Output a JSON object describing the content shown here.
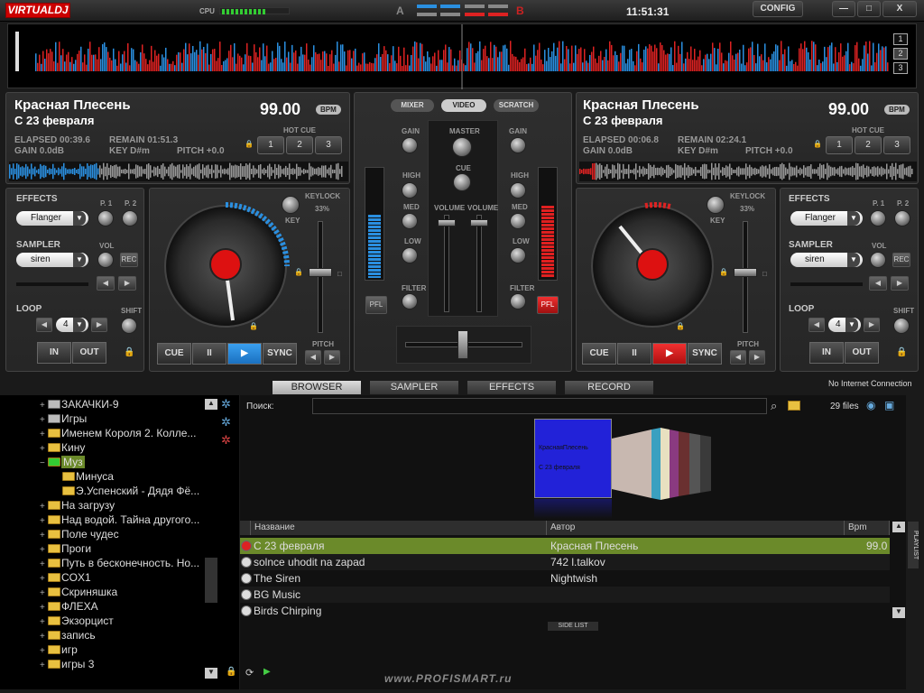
{
  "titlebar": {
    "logo": "VIRTUALDJ",
    "cpu_label": "CPU",
    "deck_a_label": "A",
    "deck_b_label": "B",
    "clock": "11:51:31",
    "config_label": "CONFIG",
    "minimize_label": "—",
    "maximize_label": "□",
    "close_label": "X"
  },
  "overview": {
    "zoom_buttons": [
      "1",
      "2",
      "3"
    ]
  },
  "deck_left": {
    "title": "Красная Плесень",
    "subtitle": "С 23 февраля",
    "bpm": "99.00",
    "bpm_tag": "BPM",
    "elapsed": "ELAPSED 00:39.6",
    "remain": "REMAIN 01:51.3",
    "gain": "GAIN 0.0dB",
    "key": "KEY D#m",
    "pitch": "PITCH +0.0",
    "hot_cue_label": "HOT CUE",
    "hot_cues": [
      "1",
      "2",
      "3"
    ],
    "effects_label": "EFFECTS",
    "p1": "P. 1",
    "p2": "P. 2",
    "effect": "Flanger",
    "sampler_label": "SAMPLER",
    "vol_label": "VOL",
    "sampler": "siren",
    "rec_label": "REC",
    "loop_label": "LOOP",
    "shift_label": "SHIFT",
    "loop_value": "4",
    "in_label": "IN",
    "out_label": "OUT",
    "keylock_label": "KEYLOCK",
    "key_knob_label": "KEY",
    "keylock_value": "33%",
    "pitch_label": "PITCH",
    "cue_label": "CUE",
    "pause_label": "II",
    "play_label": "▶",
    "sync_label": "SYNC"
  },
  "deck_right": {
    "title": "Красная Плесень",
    "subtitle": "С 23 февраля",
    "bpm": "99.00",
    "bpm_tag": "BPM",
    "elapsed": "ELAPSED 00:06.8",
    "remain": "REMAIN 02:24.1",
    "gain": "GAIN 0.0dB",
    "key": "KEY D#m",
    "pitch": "PITCH +0.0",
    "hot_cue_label": "HOT CUE",
    "hot_cues": [
      "1",
      "2",
      "3"
    ],
    "effects_label": "EFFECTS",
    "p1": "P. 1",
    "p2": "P. 2",
    "effect": "Flanger",
    "sampler_label": "SAMPLER",
    "vol_label": "VOL",
    "sampler": "siren",
    "rec_label": "REC",
    "loop_label": "LOOP",
    "shift_label": "SHIFT",
    "loop_value": "4",
    "in_label": "IN",
    "out_label": "OUT",
    "keylock_label": "KEYLOCK",
    "key_knob_label": "KEY",
    "keylock_value": "33%",
    "pitch_label": "PITCH",
    "cue_label": "CUE",
    "pause_label": "II",
    "play_label": "▶",
    "sync_label": "SYNC"
  },
  "mixer": {
    "tabs": [
      "MIXER",
      "VIDEO",
      "SCRATCH"
    ],
    "gain": "GAIN",
    "master": "MASTER",
    "cue": "CUE",
    "high": "HIGH",
    "med": "MED",
    "low": "LOW",
    "filter": "FILTER",
    "volume": "VOLUME",
    "pfl": "PFL"
  },
  "browser": {
    "tabs": [
      "BROWSER",
      "SAMPLER",
      "EFFECTS",
      "RECORD"
    ],
    "connection_status": "No Internet Connection",
    "search_label": "Поиск:",
    "search_value": "",
    "file_count": "29 files",
    "cover_artist": "КраснаяПлесень",
    "cover_title": "С 23 февраля",
    "columns": [
      "Название",
      "Автор",
      "Bpm"
    ],
    "tracks": [
      {
        "title": "С 23 февраля",
        "artist": "Красная Плесень",
        "bpm": "99.0",
        "selected": true
      },
      {
        "title": "solnce uhodit na zapad",
        "artist": "742 l.talkov",
        "bpm": ""
      },
      {
        "title": "The Siren",
        "artist": "Nightwish",
        "bpm": ""
      },
      {
        "title": "BG Music",
        "artist": "",
        "bpm": ""
      },
      {
        "title": "Birds Chirping",
        "artist": "",
        "bpm": ""
      }
    ],
    "side_list_label": "SIDE LIST",
    "playlist_label": "PLAYLIST",
    "watermark": "www.PROFISMART.ru"
  },
  "tree": [
    {
      "label": "ЗАКАЧКИ-9",
      "icon": "drive-icon"
    },
    {
      "label": "Игры",
      "icon": "drive-icon"
    },
    {
      "label": "Именем Короля 2. Колле...",
      "icon": "folder-icon"
    },
    {
      "label": "Кину",
      "icon": "folder-icon"
    },
    {
      "label": "Муз",
      "icon": "folder-icon",
      "selected": true
    },
    {
      "label": "Минуса",
      "icon": "folder-icon",
      "indent": true
    },
    {
      "label": "Э.Успенский - Дядя Фё...",
      "icon": "folder-icon",
      "indent": true
    },
    {
      "label": "На загрузу",
      "icon": "folder-icon"
    },
    {
      "label": "Над водой. Тайна другого...",
      "icon": "folder-icon"
    },
    {
      "label": "Поле чудес",
      "icon": "folder-icon"
    },
    {
      "label": "Проги",
      "icon": "folder-icon"
    },
    {
      "label": "Путь в бесконечность. Но...",
      "icon": "folder-icon"
    },
    {
      "label": "COX1",
      "icon": "folder-icon"
    },
    {
      "label": "Скриняшка",
      "icon": "folder-icon"
    },
    {
      "label": "ФЛЕХА",
      "icon": "folder-icon"
    },
    {
      "label": "Экзорцист",
      "icon": "folder-icon"
    },
    {
      "label": "запись",
      "icon": "folder-icon"
    },
    {
      "label": "игр",
      "icon": "folder-icon"
    },
    {
      "label": "игры 3",
      "icon": "folder-icon"
    }
  ],
  "colors": {
    "accent_red": "#dd1111",
    "accent_blue": "#2a8fe0",
    "selected_row": "#6b8a2a"
  }
}
